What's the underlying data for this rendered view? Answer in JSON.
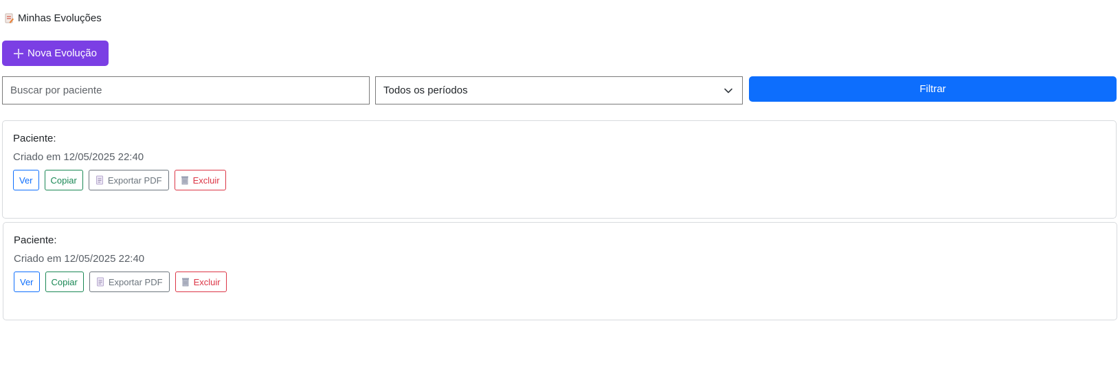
{
  "header": {
    "title": "Minhas Evoluções",
    "title_icon": "document-icon"
  },
  "toolbar": {
    "new_button_label": "Nova Evolução",
    "new_button_icon": "plus-icon",
    "new_button_color": "#7b3fe4"
  },
  "filters": {
    "search_placeholder": "Buscar por paciente",
    "search_value": "",
    "period_selected": "Todos os períodos",
    "filter_button_label": "Filtrar",
    "filter_button_color": "#0d6efd"
  },
  "evolutions": [
    {
      "patient_label": "Paciente:",
      "created_label": "Criado em 12/05/2025 22:40",
      "view_label": "Ver",
      "copy_label": "Copiar",
      "pdf_label": "Exportar PDF",
      "delete_label": "Excluir"
    },
    {
      "patient_label": "Paciente:",
      "created_label": "Criado em 12/05/2025 22:40",
      "view_label": "Ver",
      "copy_label": "Copiar",
      "pdf_label": "Exportar PDF",
      "delete_label": "Excluir"
    }
  ],
  "colors": {
    "view": "#0d6efd",
    "copy": "#198754",
    "pdf": "#6c757d",
    "delete": "#dc3545"
  }
}
